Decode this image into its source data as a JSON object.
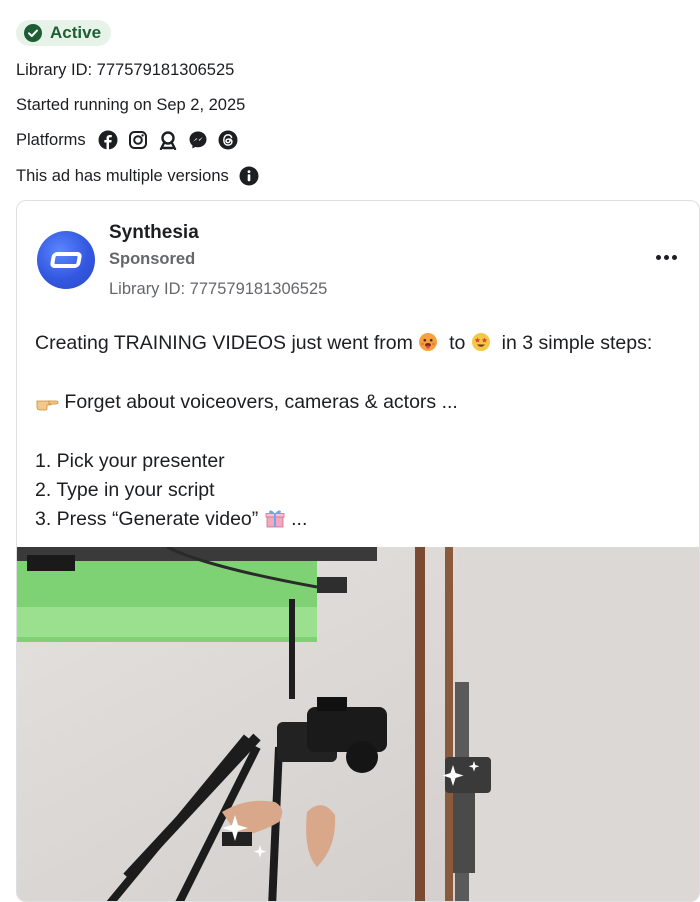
{
  "status": {
    "label": "Active",
    "color": "#1e5e33"
  },
  "library_id_line": "Library ID: 777579181306525",
  "started_line": "Started running on Sep 2, 2025",
  "platforms": {
    "label": "Platforms",
    "icons": [
      "facebook-icon",
      "instagram-icon",
      "audience-network-icon",
      "messenger-icon",
      "threads-icon"
    ]
  },
  "versions_line": "This ad has multiple versions",
  "ad": {
    "advertiser": "Synthesia",
    "sponsored": "Sponsored",
    "library_id": "Library ID: 777579181306525",
    "line1_a": "Creating TRAINING VIDEOS just went from",
    "line1_b": "to",
    "line1_c": "in 3 simple steps:",
    "line2": "Forget about voiceovers, cameras & actors ...",
    "step1": "1. Pick your presenter",
    "step2": "2. Type in your script",
    "step3": "3. Press “Generate video”",
    "ellipsis": "..."
  },
  "colors": {
    "accent_avatar": "#3358e0",
    "badge_bg": "#e7f3e8"
  }
}
